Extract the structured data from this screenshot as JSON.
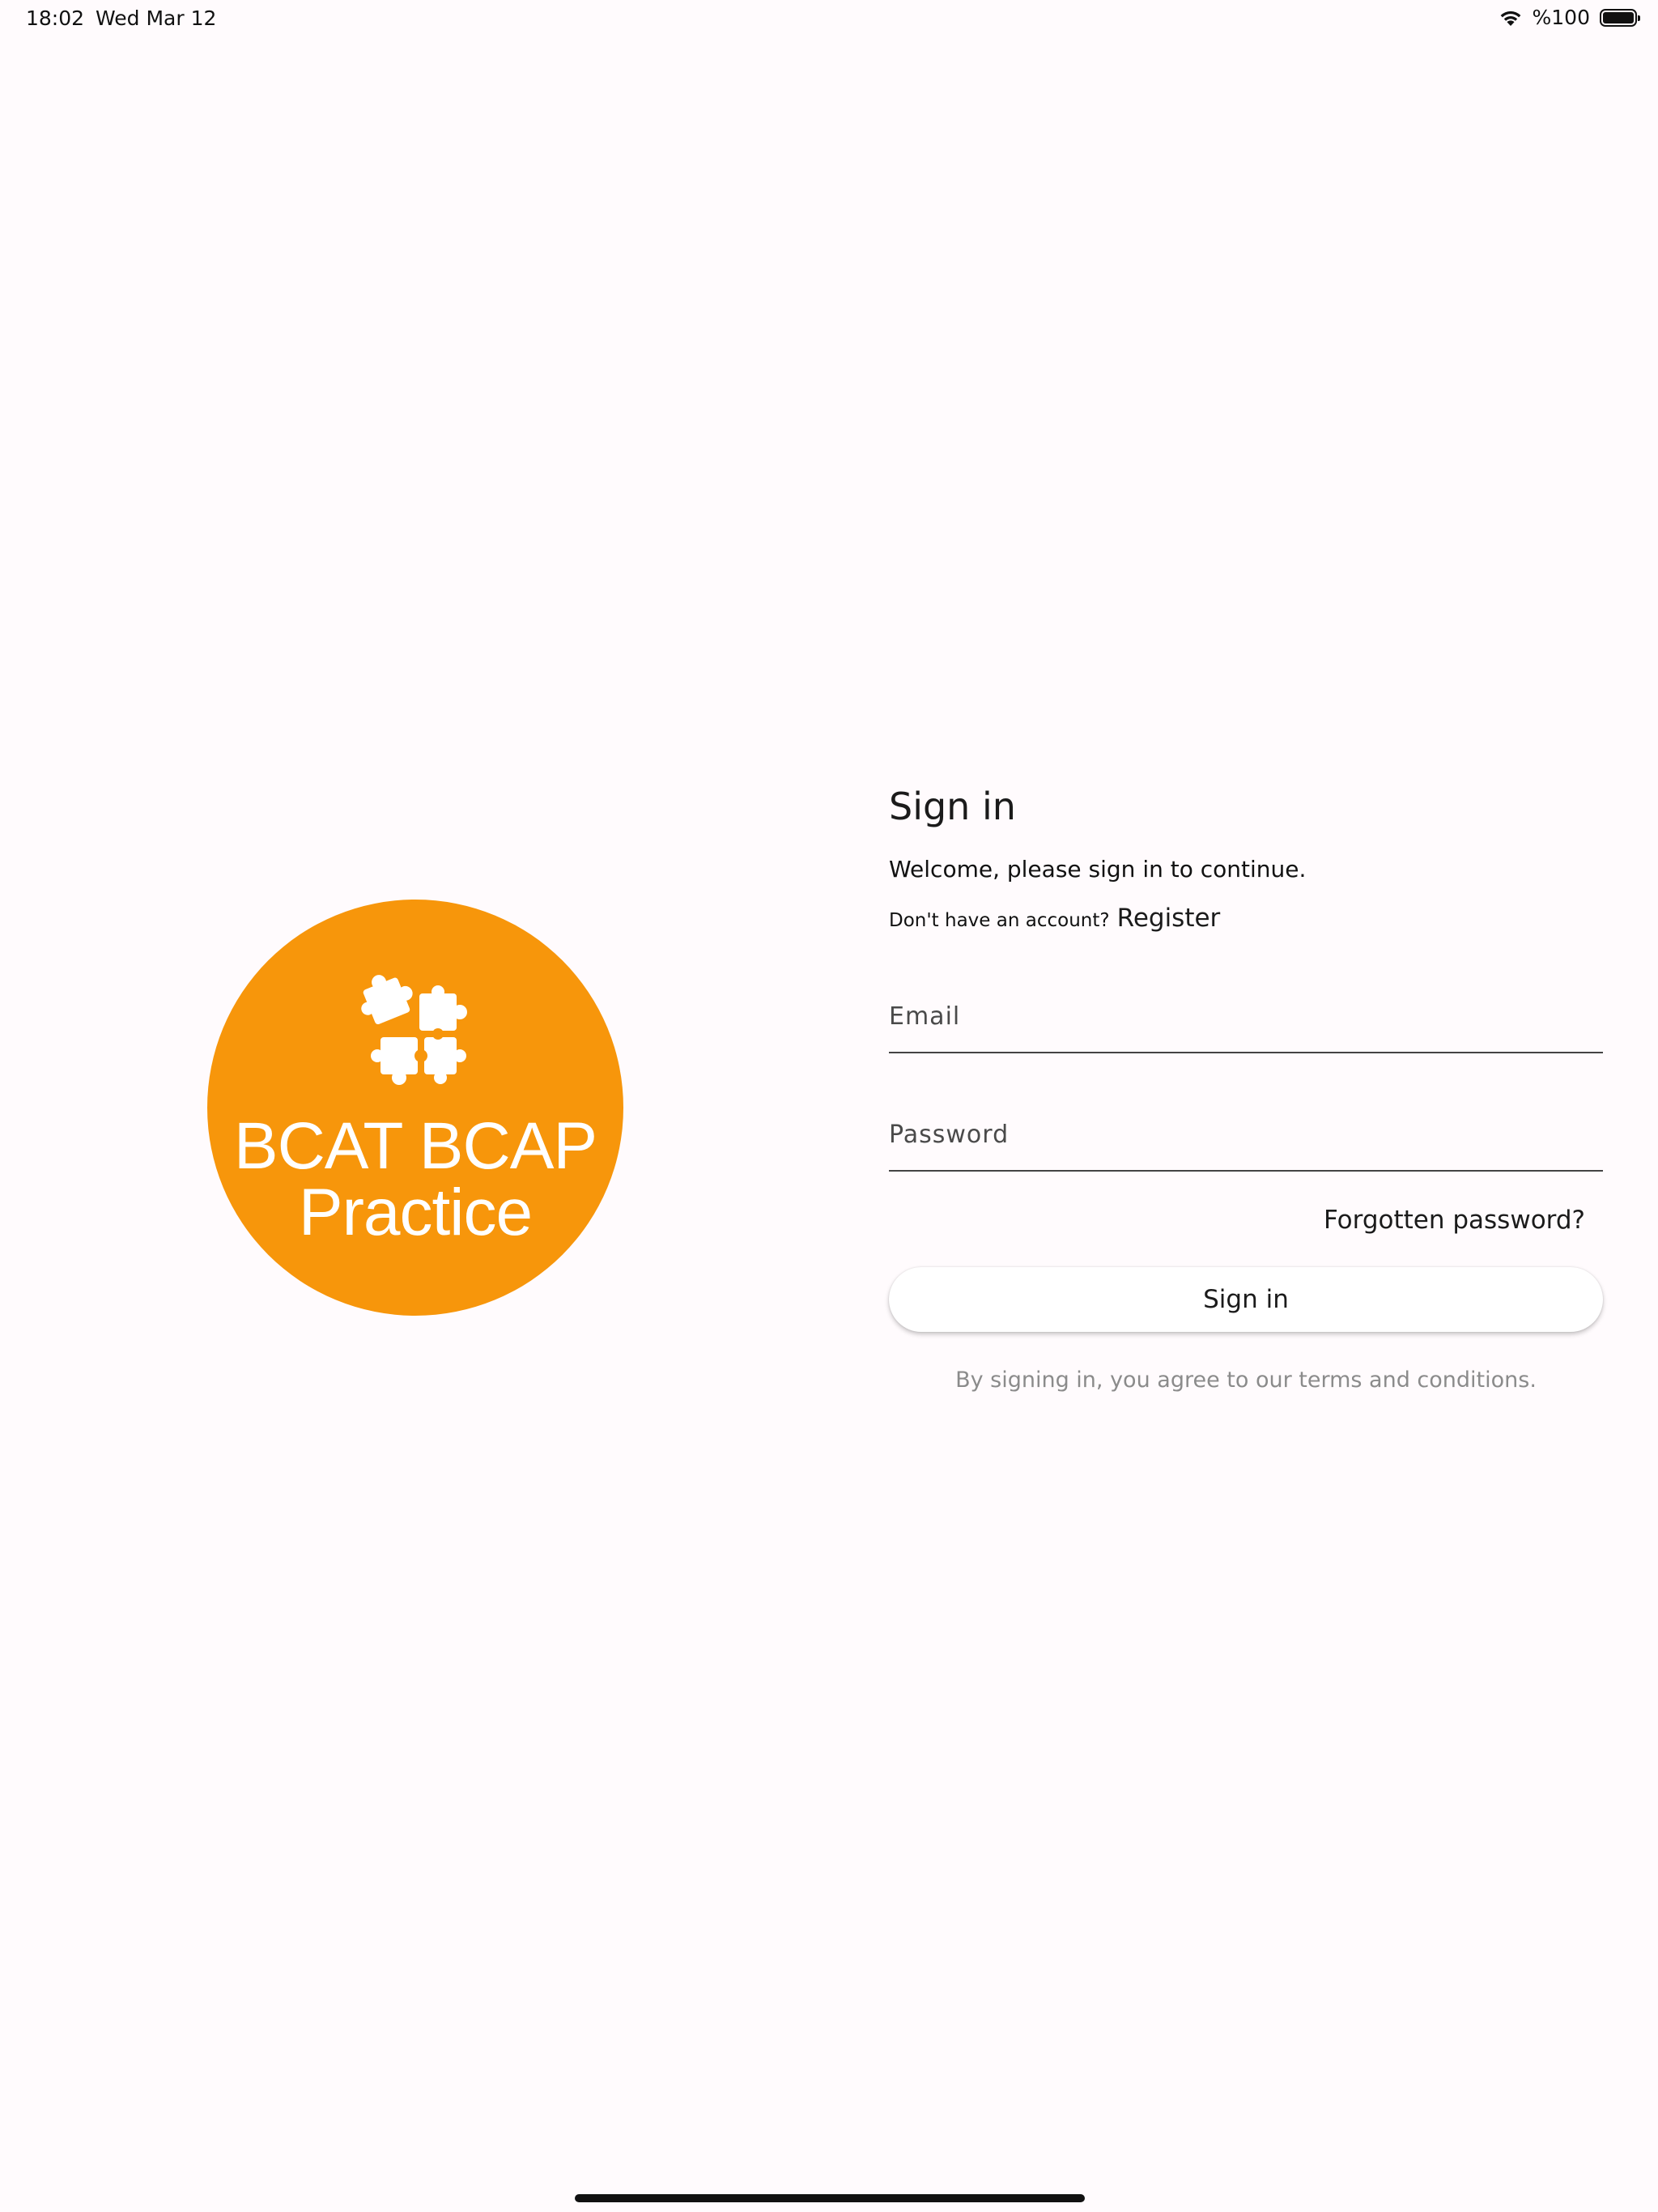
{
  "status_bar": {
    "time": "18:02",
    "date": "Wed Mar 12",
    "battery": "%100"
  },
  "logo": {
    "line1": "BCAT BCAP",
    "line2": "Practice",
    "color": "#f7960b",
    "icon": "puzzle-icon"
  },
  "signin": {
    "title": "Sign in",
    "welcome": "Welcome, please sign in to continue.",
    "no_account": "Don't have an account?",
    "register": "Register",
    "email_placeholder": "Email",
    "password_placeholder": "Password",
    "forgot": "Forgotten password?",
    "button": "Sign in",
    "terms": "By signing in, you agree to our terms and conditions."
  }
}
